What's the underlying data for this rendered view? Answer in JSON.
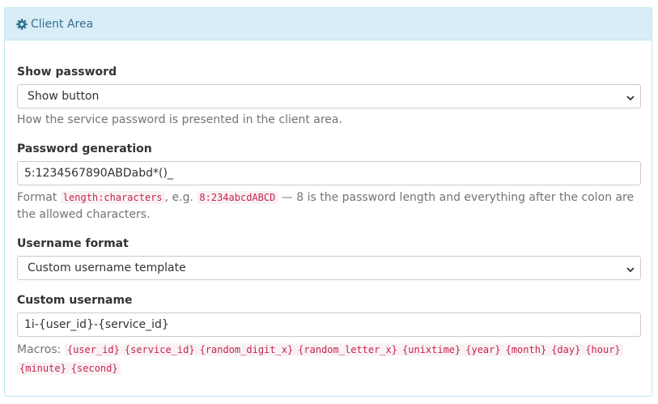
{
  "panel": {
    "title": "Client Area",
    "icon": "gear-icon",
    "accent_color": "#31708f",
    "heading_bg": "#d9edf7"
  },
  "show_password": {
    "label": "Show password",
    "selected": "Show button",
    "help": "How the service password is presented in the client area."
  },
  "password_generation": {
    "label": "Password generation",
    "value": "5:1234567890ABDabd*()_",
    "help_prefix": "Format",
    "code_format": "length:characters",
    "help_eg": ", e.g.",
    "code_example": "8:234abcdABCD",
    "help_suffix": "— 8 is the password length and everything after the colon are the allowed characters."
  },
  "username_format": {
    "label": "Username format",
    "selected": "Custom username template"
  },
  "custom_username": {
    "label": "Custom username",
    "value": "1i-{user_id}-{service_id}",
    "macros_label": "Macros:",
    "macros": [
      "{user_id}",
      "{service_id}",
      "{random_digit_x}",
      "{random_letter_x}",
      "{unixtime}",
      "{year}",
      "{month}",
      "{day}",
      "{hour}",
      "{minute}",
      "{second}"
    ]
  }
}
